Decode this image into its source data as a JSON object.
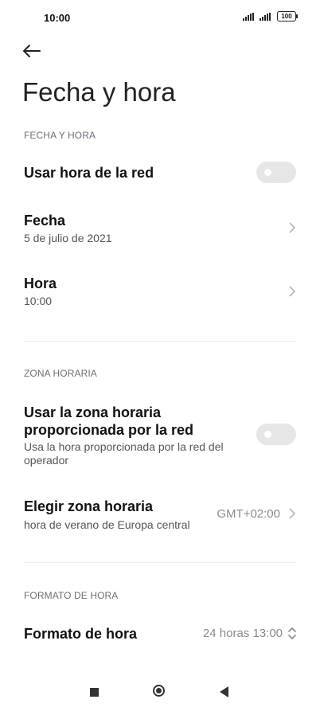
{
  "status_bar": {
    "time": "10:00",
    "battery": "100"
  },
  "header": {
    "title": "Fecha y hora"
  },
  "sections": {
    "date_time": {
      "label": "FECHA Y HORA"
    },
    "time_zone": {
      "label": "ZONA HORARIA"
    },
    "time_format": {
      "label": "FORMATO DE HORA"
    }
  },
  "rows": {
    "network_time": {
      "title": "Usar hora de la red",
      "enabled": false
    },
    "date": {
      "title": "Fecha",
      "value": "5 de julio de 2021"
    },
    "time": {
      "title": "Hora",
      "value": "10:00"
    },
    "network_zone": {
      "title_line1": "Usar la zona horaria",
      "title_line2": "proporcionada por la red",
      "subtitle_line1": "Usa la hora proporcionada por la red del",
      "subtitle_line2": "operador",
      "enabled": false
    },
    "choose_zone": {
      "title": "Elegir zona horaria",
      "subtitle": "hora de verano de Europa central",
      "value": "GMT+02:00"
    },
    "format": {
      "title": "Formato de hora",
      "value": "24 horas 13:00"
    }
  }
}
